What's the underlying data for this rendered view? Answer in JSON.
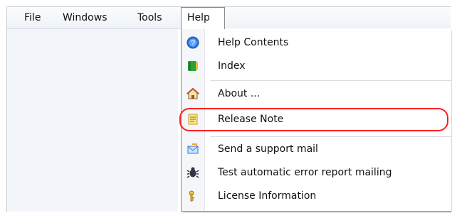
{
  "menubar": {
    "items": [
      {
        "label": "File"
      },
      {
        "label": "Windows"
      },
      {
        "label": "Tools"
      },
      {
        "label": "Help"
      }
    ],
    "open_menu": "Help"
  },
  "help_menu": {
    "items": [
      {
        "label": "Help Contents",
        "icon": "help-question-icon"
      },
      {
        "label": "Index",
        "icon": "book-index-icon"
      },
      {
        "label": "About ...",
        "icon": "home-icon"
      },
      {
        "label": "Release Note",
        "icon": "note-icon"
      },
      {
        "label": "Send a support mail",
        "icon": "mail-icon"
      },
      {
        "label": "Test automatic error report mailing",
        "icon": "bug-icon"
      },
      {
        "label": "License Information",
        "icon": "key-icon"
      }
    ],
    "highlighted_item": "Release Note"
  },
  "colors": {
    "highlight_outline": "#ff1f1f",
    "menu_border": "#8c8c8c",
    "menubar_bg": "#eef2f7"
  }
}
